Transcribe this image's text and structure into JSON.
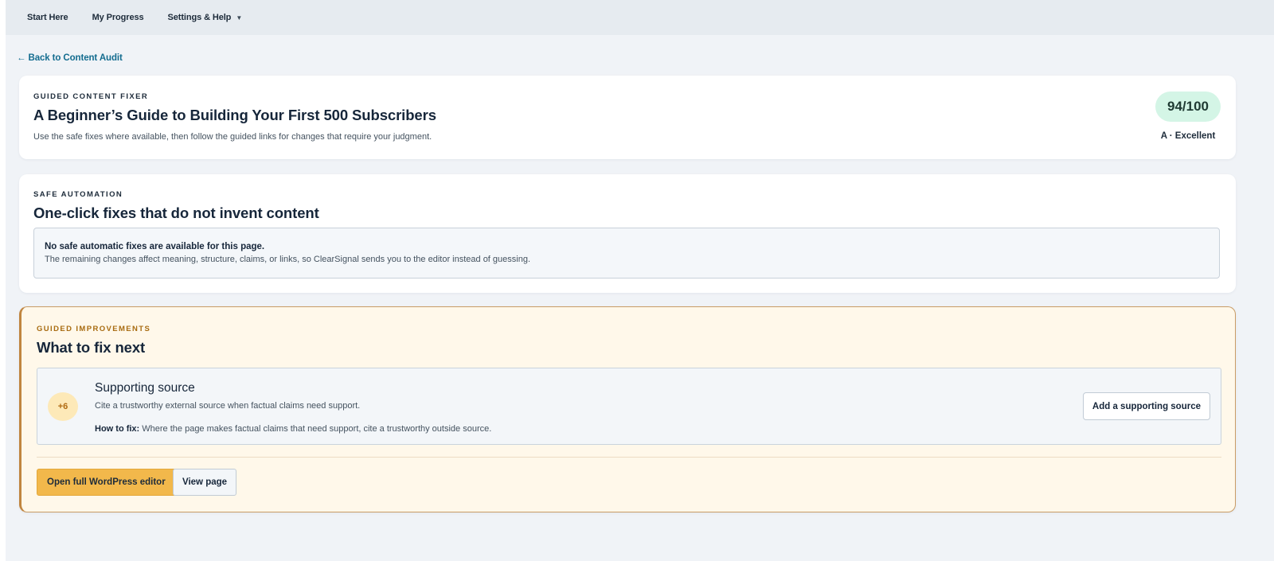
{
  "nav": {
    "items": [
      {
        "label": "Start Here"
      },
      {
        "label": "My Progress"
      },
      {
        "label": "Settings & Help"
      }
    ]
  },
  "back_link": "← Back to Content Audit",
  "fixer": {
    "eyebrow": "GUIDED CONTENT FIXER",
    "title": "A Beginner’s Guide to Building Your First 500 Subscribers",
    "description": "Use the safe fixes where available, then follow the guided links for changes that require your judgment.",
    "score": "94/100",
    "grade": "A · Excellent"
  },
  "automation": {
    "eyebrow": "SAFE AUTOMATION",
    "title": "One-click fixes that do not invent content",
    "notice_title": "No safe automatic fixes are available for this page.",
    "notice_body": "The remaining changes affect meaning, structure, claims, or links, so ClearSignal sends you to the editor instead of guessing."
  },
  "improvements": {
    "eyebrow": "GUIDED IMPROVEMENTS",
    "title": "What to fix next",
    "issue": {
      "points": "+6",
      "title": "Supporting source",
      "description": "Cite a trustworthy external source when factual claims need support.",
      "how_label": "How to fix:",
      "how_text": " Where the page makes factual claims that need support, cite a trustworthy outside source.",
      "action_label": "Add a supporting source"
    },
    "primary_button": "Open full WordPress editor",
    "view_button": "View page"
  },
  "colors": {
    "accent": "#136c8f",
    "primary_button": "#f2b84b",
    "score_bg": "#d4f5e6",
    "guided_border": "#c0853f"
  }
}
